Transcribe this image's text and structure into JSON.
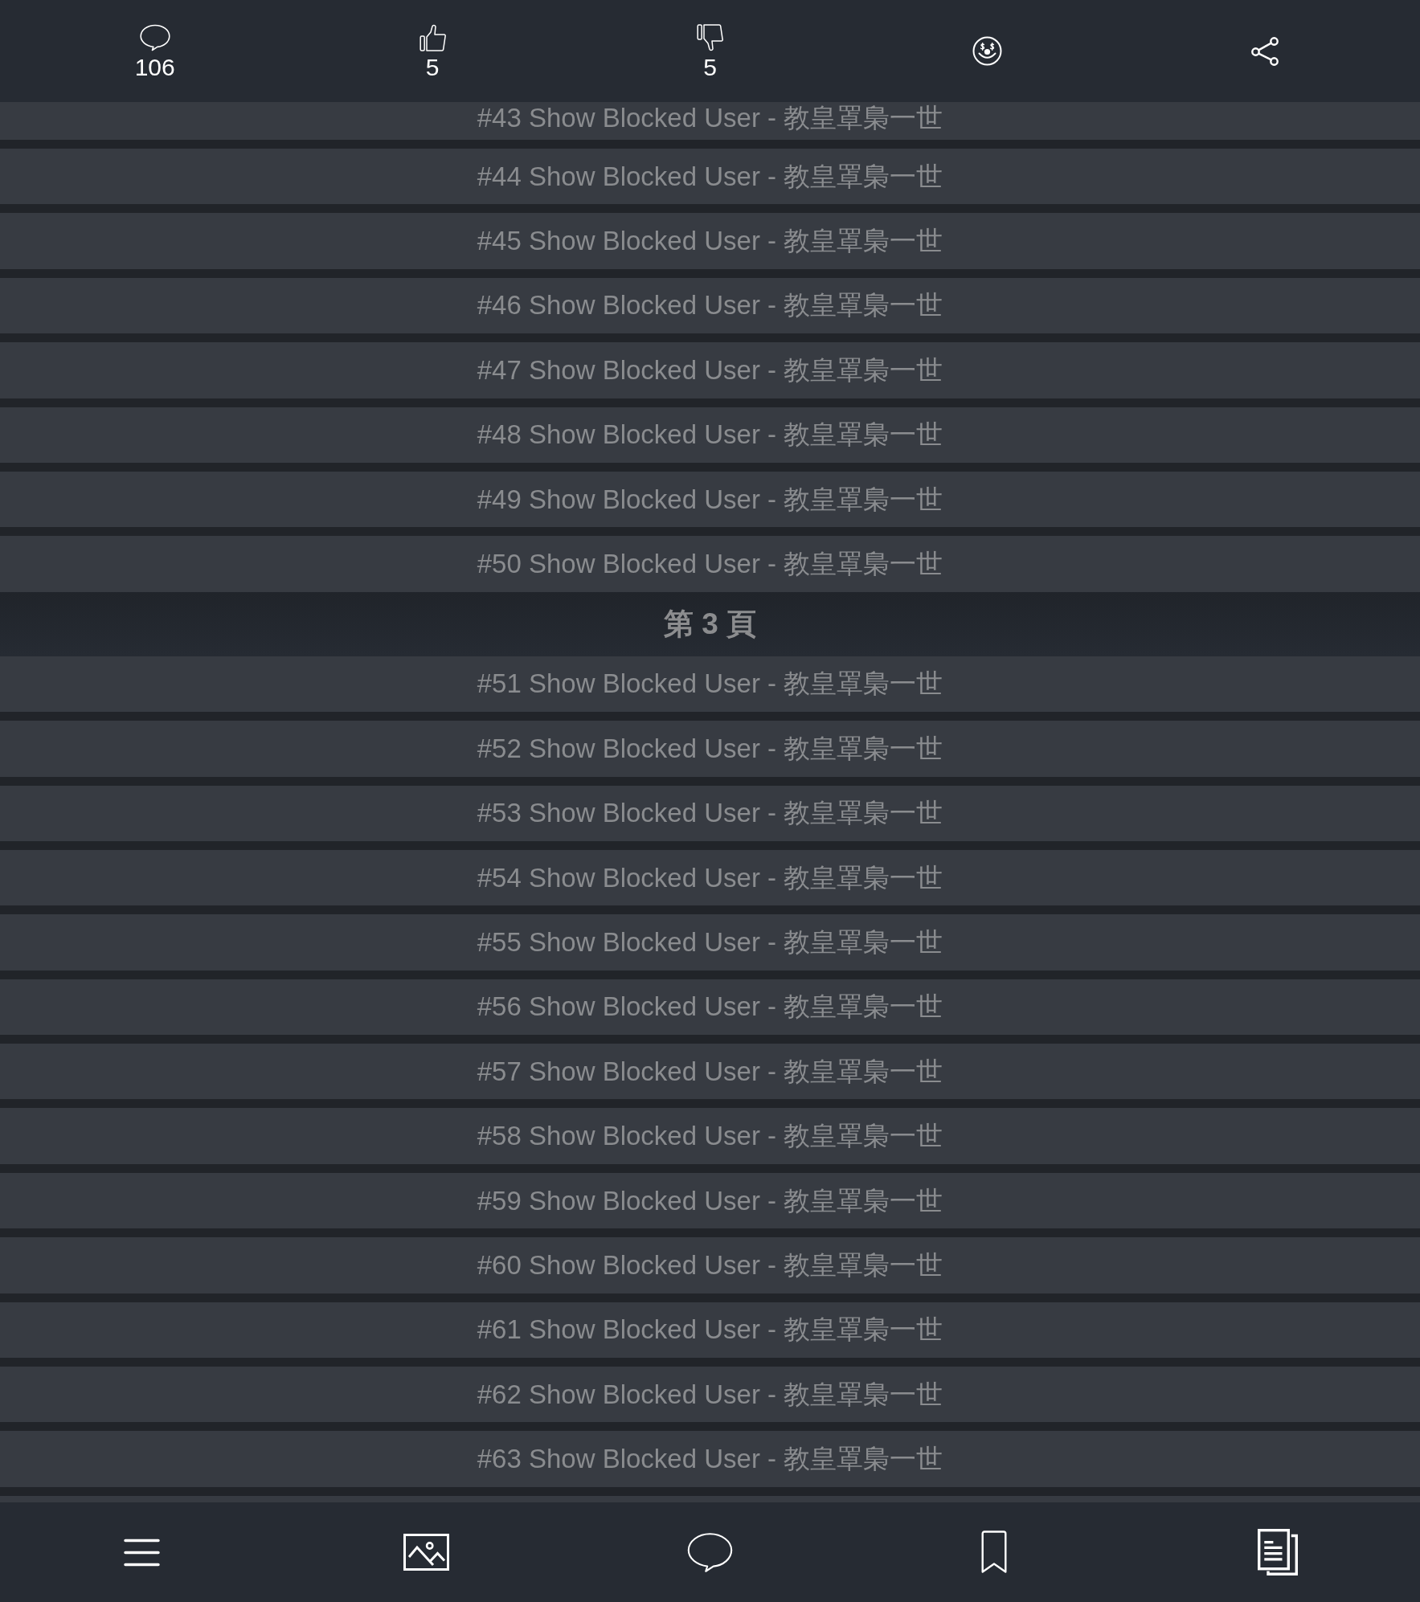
{
  "top_bar": {
    "items": [
      {
        "kind": "comments",
        "count": "106"
      },
      {
        "kind": "like",
        "count": "5"
      },
      {
        "kind": "dislike",
        "count": "5"
      },
      {
        "kind": "reaction"
      },
      {
        "kind": "share"
      }
    ]
  },
  "thread": [
    {
      "kind": "blocked",
      "label": "#43 Show Blocked User - 教皇罩梟一世"
    },
    {
      "kind": "blocked",
      "label": "#44 Show Blocked User - 教皇罩梟一世"
    },
    {
      "kind": "blocked",
      "label": "#45 Show Blocked User - 教皇罩梟一世"
    },
    {
      "kind": "blocked",
      "label": "#46 Show Blocked User - 教皇罩梟一世"
    },
    {
      "kind": "blocked",
      "label": "#47 Show Blocked User - 教皇罩梟一世"
    },
    {
      "kind": "blocked",
      "label": "#48 Show Blocked User - 教皇罩梟一世"
    },
    {
      "kind": "blocked",
      "label": "#49 Show Blocked User - 教皇罩梟一世"
    },
    {
      "kind": "blocked",
      "label": "#50 Show Blocked User - 教皇罩梟一世"
    },
    {
      "kind": "page",
      "label": "第 3 頁"
    },
    {
      "kind": "blocked",
      "label": "#51 Show Blocked User - 教皇罩梟一世"
    },
    {
      "kind": "blocked",
      "label": "#52 Show Blocked User - 教皇罩梟一世"
    },
    {
      "kind": "blocked",
      "label": "#53 Show Blocked User - 教皇罩梟一世"
    },
    {
      "kind": "blocked",
      "label": "#54 Show Blocked User - 教皇罩梟一世"
    },
    {
      "kind": "blocked",
      "label": "#55 Show Blocked User - 教皇罩梟一世"
    },
    {
      "kind": "blocked",
      "label": "#56 Show Blocked User - 教皇罩梟一世"
    },
    {
      "kind": "blocked",
      "label": "#57 Show Blocked User - 教皇罩梟一世"
    },
    {
      "kind": "blocked",
      "label": "#58 Show Blocked User - 教皇罩梟一世"
    },
    {
      "kind": "blocked",
      "label": "#59 Show Blocked User - 教皇罩梟一世"
    },
    {
      "kind": "blocked",
      "label": "#60 Show Blocked User - 教皇罩梟一世"
    },
    {
      "kind": "blocked",
      "label": "#61 Show Blocked User - 教皇罩梟一世"
    },
    {
      "kind": "blocked",
      "label": "#62 Show Blocked User - 教皇罩梟一世"
    },
    {
      "kind": "blocked",
      "label": "#63 Show Blocked User - 教皇罩梟一世"
    }
  ],
  "bottom_bar": {
    "items": [
      {
        "kind": "menu"
      },
      {
        "kind": "images"
      },
      {
        "kind": "comment"
      },
      {
        "kind": "bookmark"
      },
      {
        "kind": "pages"
      }
    ]
  }
}
